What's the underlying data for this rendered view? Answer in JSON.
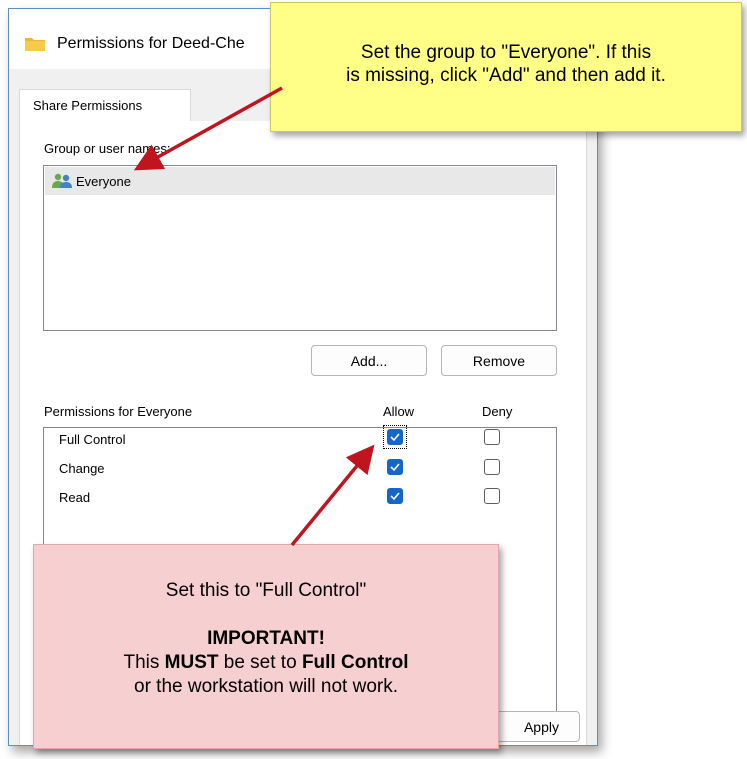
{
  "window": {
    "title": "Permissions for Deed-Che",
    "icon": "folder-icon"
  },
  "tabs": [
    {
      "label": "Share Permissions",
      "selected": true
    }
  ],
  "groups": {
    "label": "Group or user names:",
    "items": [
      {
        "name": "Everyone",
        "icon": "users-icon",
        "selected": true
      }
    ]
  },
  "buttons": {
    "add": "Add...",
    "remove": "Remove",
    "apply": "Apply"
  },
  "permissions": {
    "label": "Permissions for Everyone",
    "allow_header": "Allow",
    "deny_header": "Deny",
    "rows": [
      {
        "name": "Full Control",
        "allow": true,
        "deny": false
      },
      {
        "name": "Change",
        "allow": true,
        "deny": false
      },
      {
        "name": "Read",
        "allow": true,
        "deny": false
      }
    ]
  },
  "callouts": {
    "group": {
      "line1": "Set the group to \"Everyone\". If this",
      "line2": "is missing, click \"Add\" and then add it."
    },
    "permission": {
      "line1": "Set this to \"Full Control\"",
      "important": "IMPORTANT!",
      "line2_pre": "This",
      "line2_bold": "MUST",
      "line2_mid": "be set to",
      "line2_bold2": "Full Control",
      "line3": "or the workstation will not work."
    }
  },
  "colors": {
    "checkbox_checked": "#1466c8",
    "arrow": "#c0141e",
    "callout_yellow": "#ffff88",
    "callout_pink": "#f6cfd1"
  }
}
